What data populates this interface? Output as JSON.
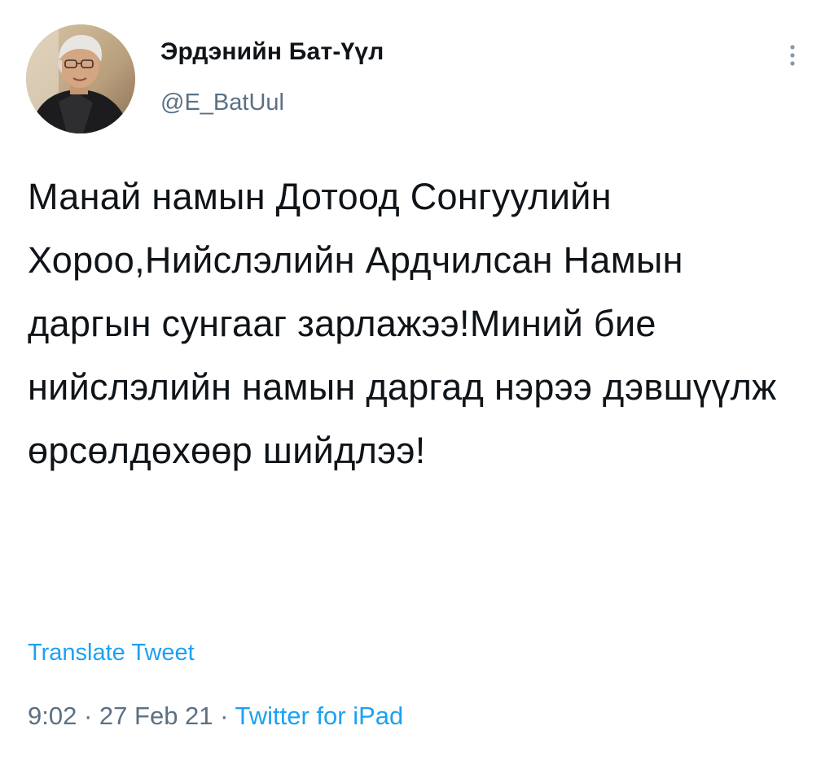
{
  "author": {
    "display_name": "Эрдэнийн Бат-Үүл",
    "handle": "@E_BatUul"
  },
  "tweet": {
    "text": "Манай намын Дотоод Сонгуулийн Хороо,Нийслэлийн Ардчилсан Намын даргын сунгааг зарлажээ!Миний бие нийслэлийн намын даргад нэрээ дэвшүүлж өрсөлдөхөөр шийдлээ!",
    "translate_label": "Translate Tweet",
    "time": "9:02",
    "date": "27 Feb 21",
    "separator": "·",
    "source": "Twitter for iPad"
  },
  "icons": {
    "more": "more-vertical-icon",
    "avatar": "profile-photo"
  },
  "colors": {
    "accent": "#1da1f2",
    "text_primary": "#0f1419",
    "text_secondary": "#5b7083"
  }
}
